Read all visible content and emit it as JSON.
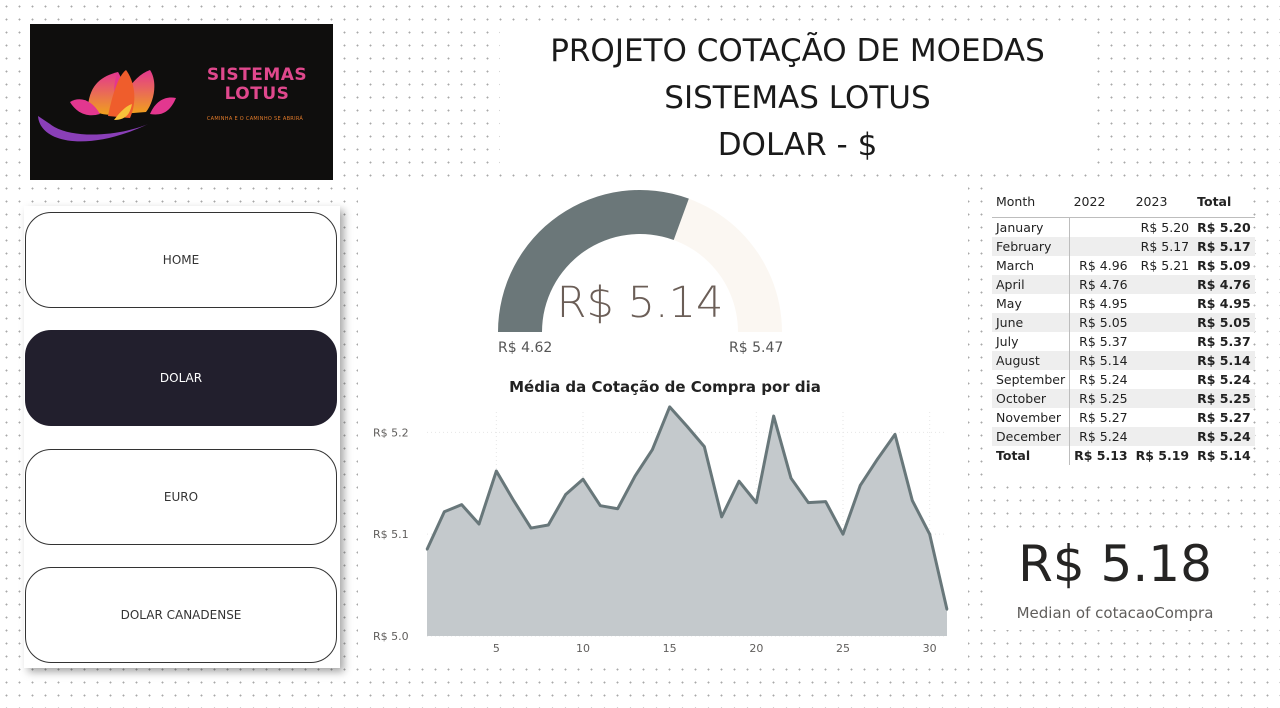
{
  "logo": {
    "brand_line1": "SISTEMAS",
    "brand_line2": "LOTUS",
    "tagline": "CAMINHA E O CAMINHO SE ABRIRÁ"
  },
  "title": {
    "line1": "PROJETO COTAÇÃO DE MOEDAS",
    "line2": "SISTEMAS LOTUS",
    "line3": "DOLAR - $"
  },
  "nav": [
    {
      "label": "HOME",
      "active": false
    },
    {
      "label": "DOLAR",
      "active": true
    },
    {
      "label": "EURO",
      "active": false
    },
    {
      "label": "DOLAR CANADENSE",
      "active": false
    }
  ],
  "gauge": {
    "value": 5.14,
    "min": 4.62,
    "max": 5.47,
    "value_label": "R$ 5.14",
    "min_label": "R$ 4.62",
    "max_label": "R$ 5.47",
    "fill_color": "#6b7779",
    "track_color": "#fbf7f2"
  },
  "chart_data": {
    "type": "area",
    "title": "Média da Cotação de Compra por dia",
    "x": [
      1,
      2,
      3,
      4,
      5,
      6,
      7,
      8,
      9,
      10,
      11,
      12,
      13,
      14,
      15,
      16,
      17,
      18,
      19,
      20,
      21,
      22,
      23,
      24,
      25,
      26,
      27,
      28,
      29,
      30,
      31
    ],
    "values": [
      5.085,
      5.122,
      5.129,
      5.11,
      5.162,
      5.133,
      5.106,
      5.109,
      5.139,
      5.154,
      5.128,
      5.125,
      5.157,
      5.183,
      5.225,
      5.206,
      5.186,
      5.117,
      5.152,
      5.131,
      5.216,
      5.155,
      5.131,
      5.132,
      5.1,
      5.148,
      5.174,
      5.198,
      5.133,
      5.1,
      5.026
    ],
    "ylim": [
      5.0,
      5.22
    ],
    "yticks": [
      5.0,
      5.1,
      5.2
    ],
    "ytick_labels": [
      "R$ 5.0",
      "R$ 5.1",
      "R$ 5.2"
    ],
    "xticks": [
      5,
      10,
      15,
      20,
      25,
      30
    ],
    "xtick_labels": [
      "5",
      "10",
      "15",
      "20",
      "25",
      "30"
    ],
    "xlim": [
      1,
      31
    ],
    "line_color": "#68777a",
    "fill_color": "#c4c9cc",
    "grid": true
  },
  "table": {
    "headers": [
      "Month",
      "2022",
      "2023",
      "Total"
    ],
    "rows": [
      [
        "January",
        "",
        "R$ 5.20",
        "R$ 5.20"
      ],
      [
        "February",
        "",
        "R$ 5.17",
        "R$ 5.17"
      ],
      [
        "March",
        "R$ 4.96",
        "R$ 5.21",
        "R$ 5.09"
      ],
      [
        "April",
        "R$ 4.76",
        "",
        "R$ 4.76"
      ],
      [
        "May",
        "R$ 4.95",
        "",
        "R$ 4.95"
      ],
      [
        "June",
        "R$ 5.05",
        "",
        "R$ 5.05"
      ],
      [
        "July",
        "R$ 5.37",
        "",
        "R$ 5.37"
      ],
      [
        "August",
        "R$ 5.14",
        "",
        "R$ 5.14"
      ],
      [
        "September",
        "R$ 5.24",
        "",
        "R$ 5.24"
      ],
      [
        "October",
        "R$ 5.25",
        "",
        "R$ 5.25"
      ],
      [
        "November",
        "R$ 5.27",
        "",
        "R$ 5.27"
      ],
      [
        "December",
        "R$ 5.24",
        "",
        "R$ 5.24"
      ]
    ],
    "total_row": [
      "Total",
      "R$ 5.13",
      "R$ 5.19",
      "R$ 5.14"
    ]
  },
  "card": {
    "value": "R$ 5.18",
    "label": "Median of cotacaoCompra"
  }
}
